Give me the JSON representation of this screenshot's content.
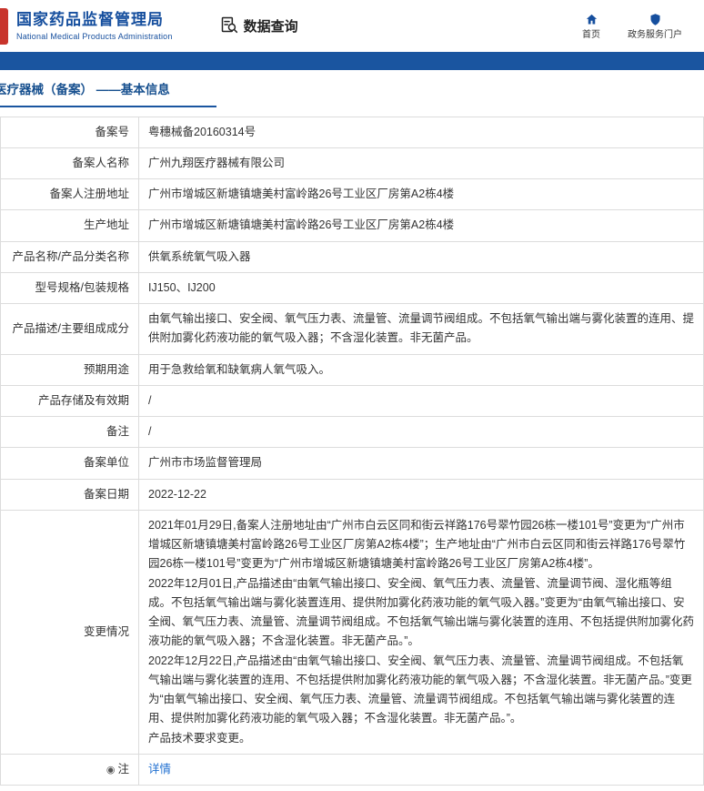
{
  "header": {
    "agency_cn": "国家药品监督管理局",
    "agency_en": "National Medical Products Administration",
    "nav_title": "数据查询",
    "home_label": "首页",
    "portal_label": "政务服务门户",
    "brand_color": "#164f9e",
    "logo_color": "#c8342c"
  },
  "page": {
    "section_title": "医疗器械（备案） ——基本信息",
    "band_color": "#1a55a0"
  },
  "table": {
    "rows": [
      {
        "label": "备案号",
        "value": "粤穗械备20160314号"
      },
      {
        "label": "备案人名称",
        "value": "广州九翔医疗器械有限公司"
      },
      {
        "label": "备案人注册地址",
        "value": "广州市增城区新塘镇塘美村富岭路26号工业区厂房第A2栋4楼"
      },
      {
        "label": "生产地址",
        "value": "广州市增城区新塘镇塘美村富岭路26号工业区厂房第A2栋4楼"
      },
      {
        "label": "产品名称/产品分类名称",
        "value": "供氧系统氧气吸入器"
      },
      {
        "label": "型号规格/包装规格",
        "value": "IJ150、IJ200"
      },
      {
        "label": "产品描述/主要组成成分",
        "value": "由氧气输出接口、安全阀、氧气压力表、流量管、流量调节阀组成。不包括氧气输出端与雾化装置的连用、提供附加雾化药液功能的氧气吸入器；不含湿化装置。非无菌产品。"
      },
      {
        "label": "预期用途",
        "value": "用于急救给氧和缺氧病人氧气吸入。"
      },
      {
        "label": "产品存储及有效期",
        "value": "/"
      },
      {
        "label": "备注",
        "value": "/"
      },
      {
        "label": "备案单位",
        "value": "广州市市场监督管理局"
      },
      {
        "label": "备案日期",
        "value": "2022-12-22"
      },
      {
        "label": "变更情况",
        "multiline": true,
        "value": "2021年01月29日,备案人注册地址由“广州市白云区同和街云祥路176号翠竹园26栋一楼101号”变更为“广州市增城区新塘镇塘美村富岭路26号工业区厂房第A2栋4楼”；生产地址由“广州市白云区同和街云祥路176号翠竹园26栋一楼101号”变更为“广州市增城区新塘镇塘美村富岭路26号工业区厂房第A2栋4楼”。\n2022年12月01日,产品描述由“由氧气输出接口、安全阀、氧气压力表、流量管、流量调节阀、湿化瓶等组成。不包括氧气输出端与雾化装置连用、提供附加雾化药液功能的氧气吸入器。”变更为“由氧气输出接口、安全阀、氧气压力表、流量管、流量调节阀组成。不包括氧气输出端与雾化装置的连用、不包括提供附加雾化药液功能的氧气吸入器；不含湿化装置。非无菌产品。”。\n2022年12月22日,产品描述由“由氧气输出接口、安全阀、氧气压力表、流量管、流量调节阀组成。不包括氧气输出端与雾化装置的连用、不包括提供附加雾化药液功能的氧气吸入器；不含湿化装置。非无菌产品。”变更为“由氧气输出接口、安全阀、氧气压力表、流量管、流量调节阀组成。不包括氧气输出端与雾化装置的连用、提供附加雾化药液功能的氧气吸入器；不含湿化装置。非无菌产品。”。\n产品技术要求变更。"
      },
      {
        "label": "注",
        "icon": true,
        "link": true,
        "value": "详情"
      }
    ]
  }
}
